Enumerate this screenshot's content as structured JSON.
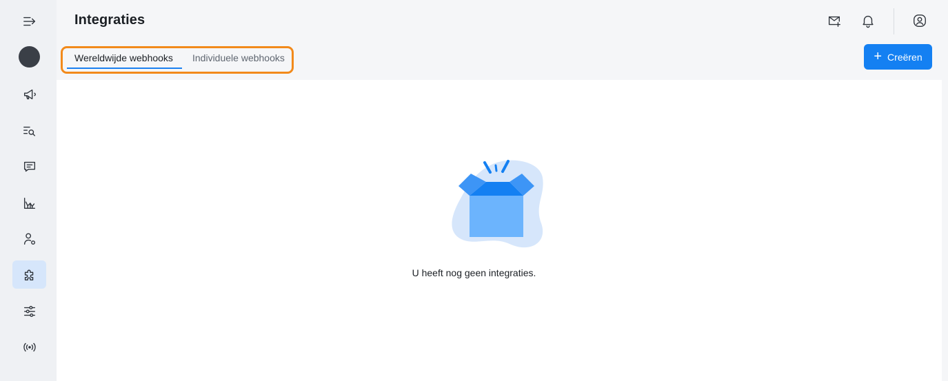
{
  "header": {
    "title": "Integraties"
  },
  "tabs": [
    {
      "label": "Wereldwijde webhooks",
      "active": true
    },
    {
      "label": "Individuele webhooks",
      "active": false
    }
  ],
  "actions": {
    "create_label": "Creëren"
  },
  "empty_state": {
    "message": "U heeft nog geen integraties."
  },
  "sidebar": {
    "items": [
      {
        "icon": "expand-menu-icon"
      },
      {
        "icon": "avatar"
      },
      {
        "icon": "megaphone-icon"
      },
      {
        "icon": "search-list-icon"
      },
      {
        "icon": "chat-icon"
      },
      {
        "icon": "chart-icon"
      },
      {
        "icon": "user-settings-icon"
      },
      {
        "icon": "puzzle-icon",
        "active": true
      },
      {
        "icon": "sliders-icon"
      },
      {
        "icon": "broadcast-icon"
      }
    ]
  },
  "topbar_icons": [
    "mail-add-icon",
    "bell-icon",
    "user-circle-icon"
  ],
  "colors": {
    "accent": "#1480f2",
    "highlight": "#f28a1b",
    "sidebar_active": "#d6e6fb"
  }
}
